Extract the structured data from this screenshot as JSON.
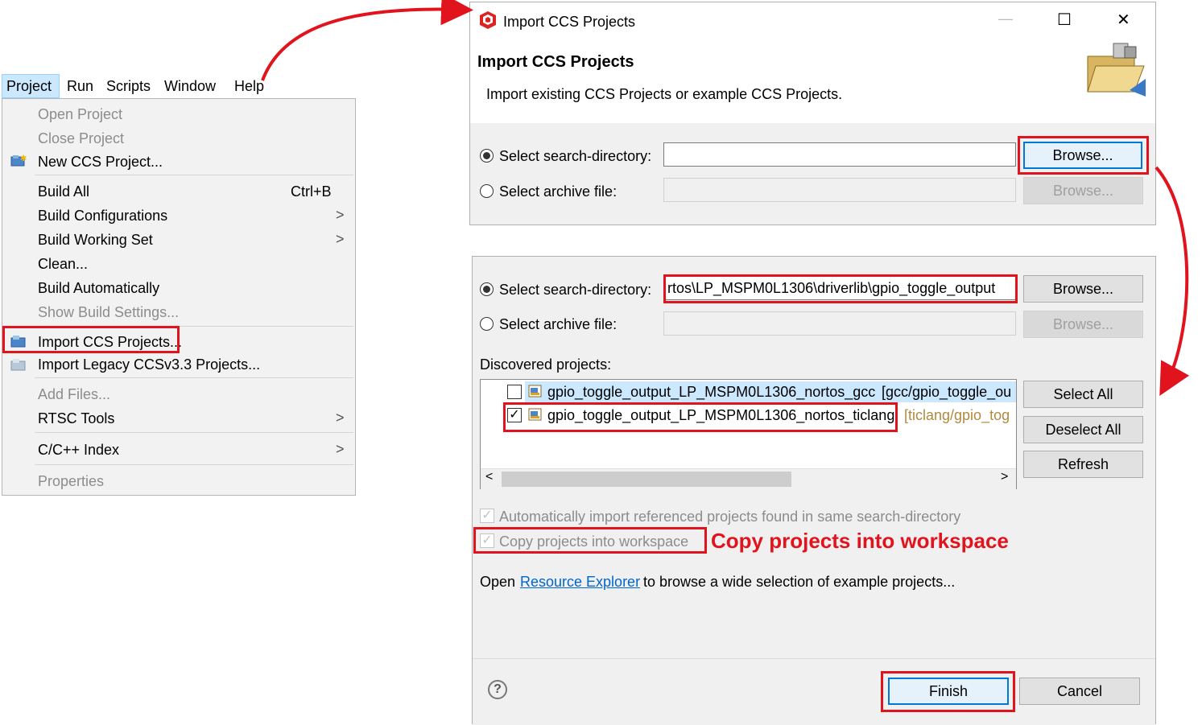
{
  "menu": {
    "bar": [
      "Project",
      "Run",
      "Scripts",
      "Window",
      "Help"
    ],
    "items": {
      "open_project": "Open Project",
      "close_project": "Close Project",
      "new_ccs_project": "New CCS Project...",
      "build_all": "Build All",
      "build_all_shortcut": "Ctrl+B",
      "build_configurations": "Build Configurations",
      "build_working_set": "Build Working Set",
      "clean": "Clean...",
      "build_automatically": "Build Automatically",
      "show_build_settings": "Show Build Settings...",
      "import_ccs_projects": "Import CCS Projects...",
      "import_legacy": "Import Legacy CCSv3.3 Projects...",
      "add_files": "Add Files...",
      "rtsc_tools": "RTSC Tools",
      "cpp_index": "C/C++ Index",
      "properties": "Properties"
    },
    "submenu_arrow": ">"
  },
  "dialog": {
    "window_title": "Import CCS Projects",
    "heading": "Import CCS Projects",
    "description": "Import existing CCS Projects or example CCS Projects.",
    "window_controls": {
      "minimize": "—",
      "maximize": "☐",
      "close": "✕"
    },
    "top_section": {
      "search_dir_label": "Select search-directory:",
      "search_dir_value": "",
      "archive_label": "Select archive file:",
      "browse": "Browse..."
    },
    "bottom_section": {
      "search_dir_label": "Select search-directory:",
      "search_dir_value": "rtos\\LP_MSPM0L1306\\driverlib\\gpio_toggle_output",
      "archive_label": "Select archive file:",
      "browse": "Browse...",
      "discovered_label": "Discovered projects:",
      "projects": [
        {
          "name": "gpio_toggle_output_LP_MSPM0L1306_nortos_gcc",
          "path": "[gcc/gpio_toggle_ou",
          "checked": false
        },
        {
          "name": "gpio_toggle_output_LP_MSPM0L1306_nortos_ticlang",
          "path": "[ticlang/gpio_tog",
          "checked": true
        }
      ],
      "select_all": "Select All",
      "deselect_all": "Deselect All",
      "refresh": "Refresh",
      "auto_import_label": "Automatically import referenced projects found in same search-directory",
      "copy_label": "Copy projects into workspace",
      "annotation": "Copy projects into workspace",
      "open_prefix": "Open",
      "resource_explorer": "Resource Explorer",
      "open_suffix": "to browse a wide selection of example projects...",
      "help": "?",
      "finish": "Finish",
      "cancel": "Cancel"
    }
  },
  "colors": {
    "highlight_red": "#e1141e",
    "link_blue": "#0066cc",
    "default_button_border": "#0078d7"
  }
}
